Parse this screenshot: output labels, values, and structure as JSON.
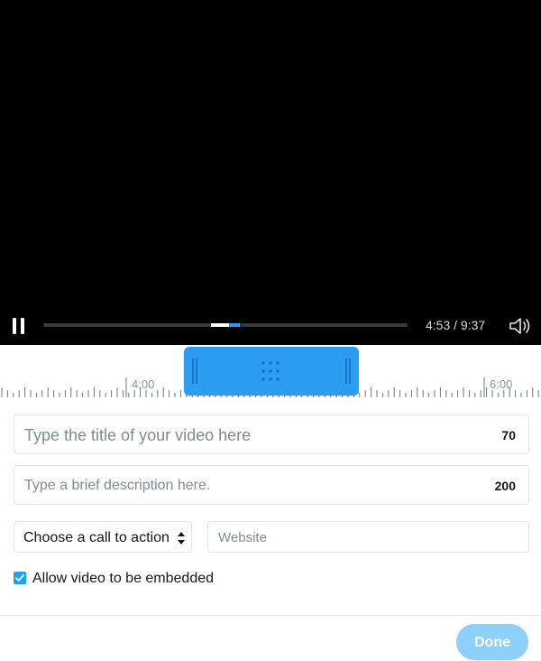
{
  "player": {
    "time_display": "4:53 / 9:37",
    "progress_fraction": 0.51,
    "accent_color": "#2b9cf0",
    "icons": {
      "pause": "pause-icon",
      "volume": "volume-icon"
    }
  },
  "timeline": {
    "labels": [
      "4:00",
      "6:00"
    ],
    "accent_color": "#2b9cf0",
    "icons": {
      "handle": "drag-grip-icon"
    }
  },
  "form": {
    "title_placeholder": "Type the title of your video here",
    "title_char_count": "70",
    "description_placeholder": "Type a brief description here.",
    "description_char_count": "200",
    "cta_selected": "Choose a call to action",
    "website_placeholder": "Website",
    "embed_label": "Allow video to be embedded",
    "embed_checked": true,
    "checkbox_color": "#1da1f2"
  },
  "footer": {
    "done_label": "Done",
    "done_color": "#8ed0f9"
  }
}
